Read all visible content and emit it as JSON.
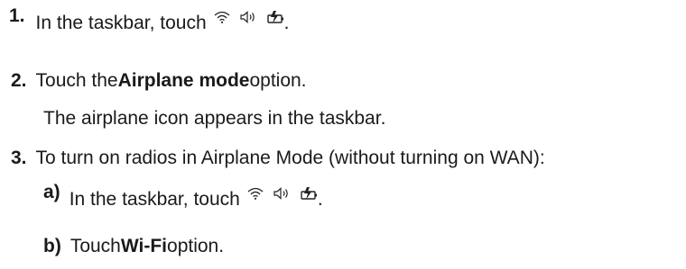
{
  "steps": [
    {
      "num": "1.",
      "text": "In the taskbar, touch",
      "after_icons": "."
    },
    {
      "num": "2.",
      "pre": "Touch the ",
      "bold": "Airplane mode",
      "post": " option.",
      "note": "The airplane icon appears in the taskbar."
    },
    {
      "num": "3.",
      "text": "To turn on radios in Airplane Mode (without turning on WAN):",
      "substeps": [
        {
          "num": "a)",
          "text": "In the taskbar, touch",
          "after_icons": "."
        },
        {
          "num": "b)",
          "pre": "Touch ",
          "bold": "Wi-Fi",
          "post": " option."
        }
      ]
    }
  ],
  "icons": [
    "wifi-icon",
    "speaker-icon",
    "battery-charging-icon"
  ]
}
